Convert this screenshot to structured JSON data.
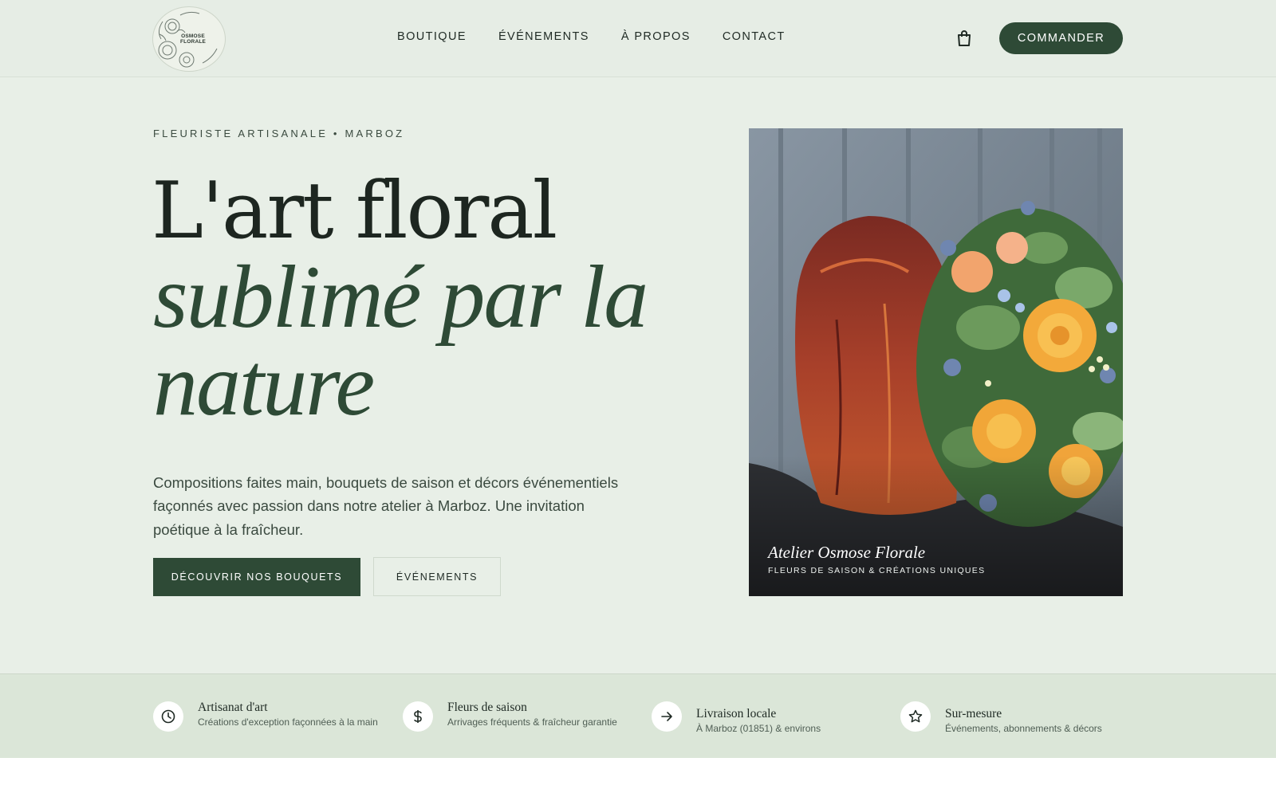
{
  "brand": {
    "logo_text_line1": "OSMOSE",
    "logo_text_line2": "FLORALE"
  },
  "nav": {
    "items": [
      "BOUTIQUE",
      "ÉVÉNEMENTS",
      "À PROPOS",
      "CONTACT"
    ],
    "cart_icon": "shopping-bag-icon",
    "cta_label": "COMMANDER"
  },
  "hero": {
    "eyebrow": "FLEURISTE ARTISANALE • MARBOZ",
    "title_line1": "L'art floral",
    "title_line2": "sublimé par la nature",
    "description": "Compositions faites main, bouquets de saison et décors événementiels façonnés avec passion dans notre atelier à Marboz. Une invitation poétique à la fraîcheur.",
    "primary_button": "DÉCOUVRIR NOS BOUQUETS",
    "secondary_button": "ÉVÉNEMENTS",
    "photo_caption_title": "Atelier Osmose Florale",
    "photo_caption_subtitle": "FLEURS DE SAISON & CRÉATIONS UNIQUES"
  },
  "features": [
    {
      "icon": "clock-icon",
      "title": "Artisanat d'art",
      "text": "Créations d'exception façonnées à la main"
    },
    {
      "icon": "dollar-icon",
      "title": "Fleurs de saison",
      "text": "Arrivages fréquents & fraîcheur garantie"
    },
    {
      "icon": "arrow-right-icon",
      "title": "Livraison locale",
      "text": "À Marboz (01851) & environs"
    },
    {
      "icon": "star-icon",
      "title": "Sur-mesure",
      "text": "Événements, abonnements & décors"
    }
  ],
  "colors": {
    "background": "#e8efe7",
    "accent_green": "#2e4a36",
    "features_band": "#dbe6d8"
  }
}
